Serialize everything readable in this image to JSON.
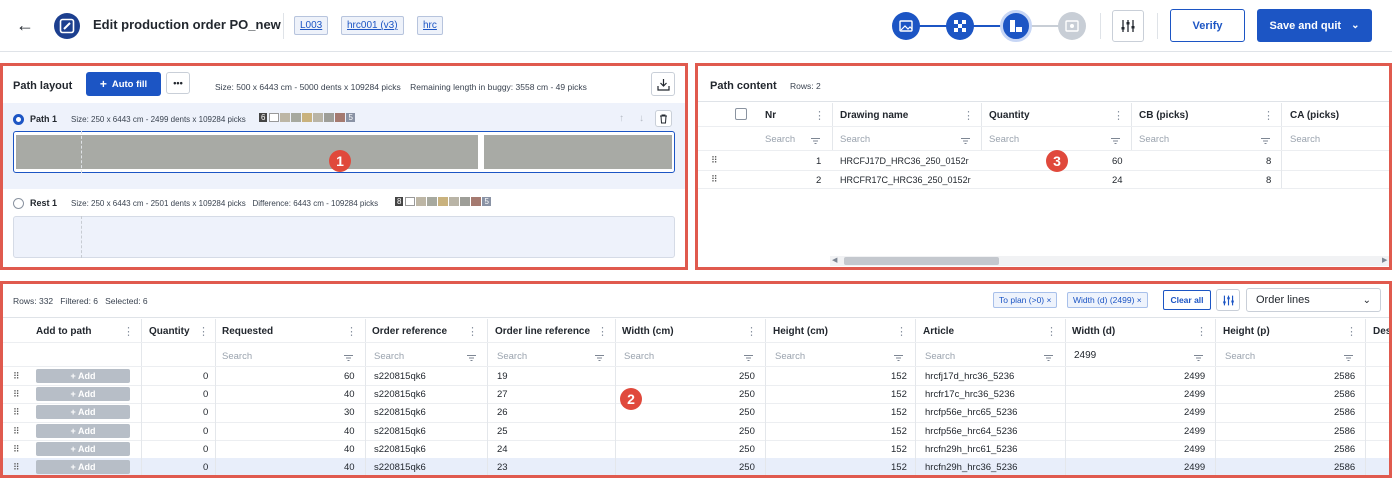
{
  "header": {
    "title": "Edit production order PO_new",
    "chips": [
      "L003",
      "hrc001 (v3)",
      "hrc"
    ],
    "verify_label": "Verify",
    "save_label": "Save and quit"
  },
  "path_layout": {
    "title": "Path layout",
    "autofill_label": "Auto fill",
    "more_label": "•••",
    "info": "Size: 500 x 6443 cm - 5000 dents x 109284 picks    Remaining length in buggy: 3558 cm - 49 picks",
    "path1_label": "Path 1",
    "path1_info": "Size: 250 x 6443 cm - 2499 dents x 109284 picks",
    "path1_count": "6",
    "rest1_label": "Rest 1",
    "rest1_info": "Size: 250 x 6443 cm - 2501 dents x 109284 picks   Difference: 6443 cm - 109284 picks",
    "rest1_count": "8",
    "path1_end_count": "5",
    "rest1_end_count": "5",
    "marker": "1"
  },
  "path_content": {
    "title": "Path content",
    "rows_label": "Rows: 2",
    "columns": [
      "Nr",
      "Drawing name",
      "Quantity",
      "CB (picks)",
      "CA (picks)"
    ],
    "search_placeholder": "Search",
    "rows": [
      {
        "nr": "1",
        "drawing": "HRCFJ17D_HRC36_250_0152r",
        "qty": "60",
        "cb": "8"
      },
      {
        "nr": "2",
        "drawing": "HRCFR17C_HRC36_250_0152r",
        "qty": "24",
        "cb": "8"
      }
    ],
    "marker": "3"
  },
  "order_lines": {
    "status": "Rows: 332   Filtered: 6   Selected: 6",
    "filter1": "To plan (>0) ×",
    "filter2": "Width (d) (2499) ×",
    "clear_all": "Clear all",
    "view_select": "Order lines",
    "columns": [
      "Add to path",
      "Quantity",
      "Requested",
      "Order reference",
      "Order line reference",
      "Width (cm)",
      "Height (cm)",
      "Article",
      "Width (d)",
      "Height (p)",
      "Des"
    ],
    "search_placeholder": "Search",
    "width_d_filter_value": "2499",
    "add_label": "+ Add",
    "rows": [
      {
        "qty": "0",
        "req": "60",
        "oref": "s220815qk6",
        "olref": "19",
        "wcm": "250",
        "hcm": "152",
        "article": "hrcfj17d_hrc36_5236",
        "wd": "2499",
        "hp": "2586"
      },
      {
        "qty": "0",
        "req": "40",
        "oref": "s220815qk6",
        "olref": "27",
        "wcm": "250",
        "hcm": "152",
        "article": "hrcfr17c_hrc36_5236",
        "wd": "2499",
        "hp": "2586"
      },
      {
        "qty": "0",
        "req": "30",
        "oref": "s220815qk6",
        "olref": "26",
        "wcm": "250",
        "hcm": "152",
        "article": "hrcfp56e_hrc65_5236",
        "wd": "2499",
        "hp": "2586"
      },
      {
        "qty": "0",
        "req": "40",
        "oref": "s220815qk6",
        "olref": "25",
        "wcm": "250",
        "hcm": "152",
        "article": "hrcfp56e_hrc64_5236",
        "wd": "2499",
        "hp": "2586"
      },
      {
        "qty": "0",
        "req": "40",
        "oref": "s220815qk6",
        "olref": "24",
        "wcm": "250",
        "hcm": "152",
        "article": "hrcfn29h_hrc61_5236",
        "wd": "2499",
        "hp": "2586"
      },
      {
        "qty": "0",
        "req": "40",
        "oref": "s220815qk6",
        "olref": "23",
        "wcm": "250",
        "hcm": "152",
        "article": "hrcfn29h_hrc36_5236",
        "wd": "2499",
        "hp": "2586"
      }
    ],
    "marker": "2"
  },
  "colors": {
    "accent": "#1c55c4",
    "highlight": "#e05a4e"
  },
  "swatches": [
    "#bdb6a5",
    "#a7a99f",
    "#c9b27e",
    "#b9b4a6",
    "#9e9e98",
    "#a57a70",
    "#8a93a5"
  ]
}
